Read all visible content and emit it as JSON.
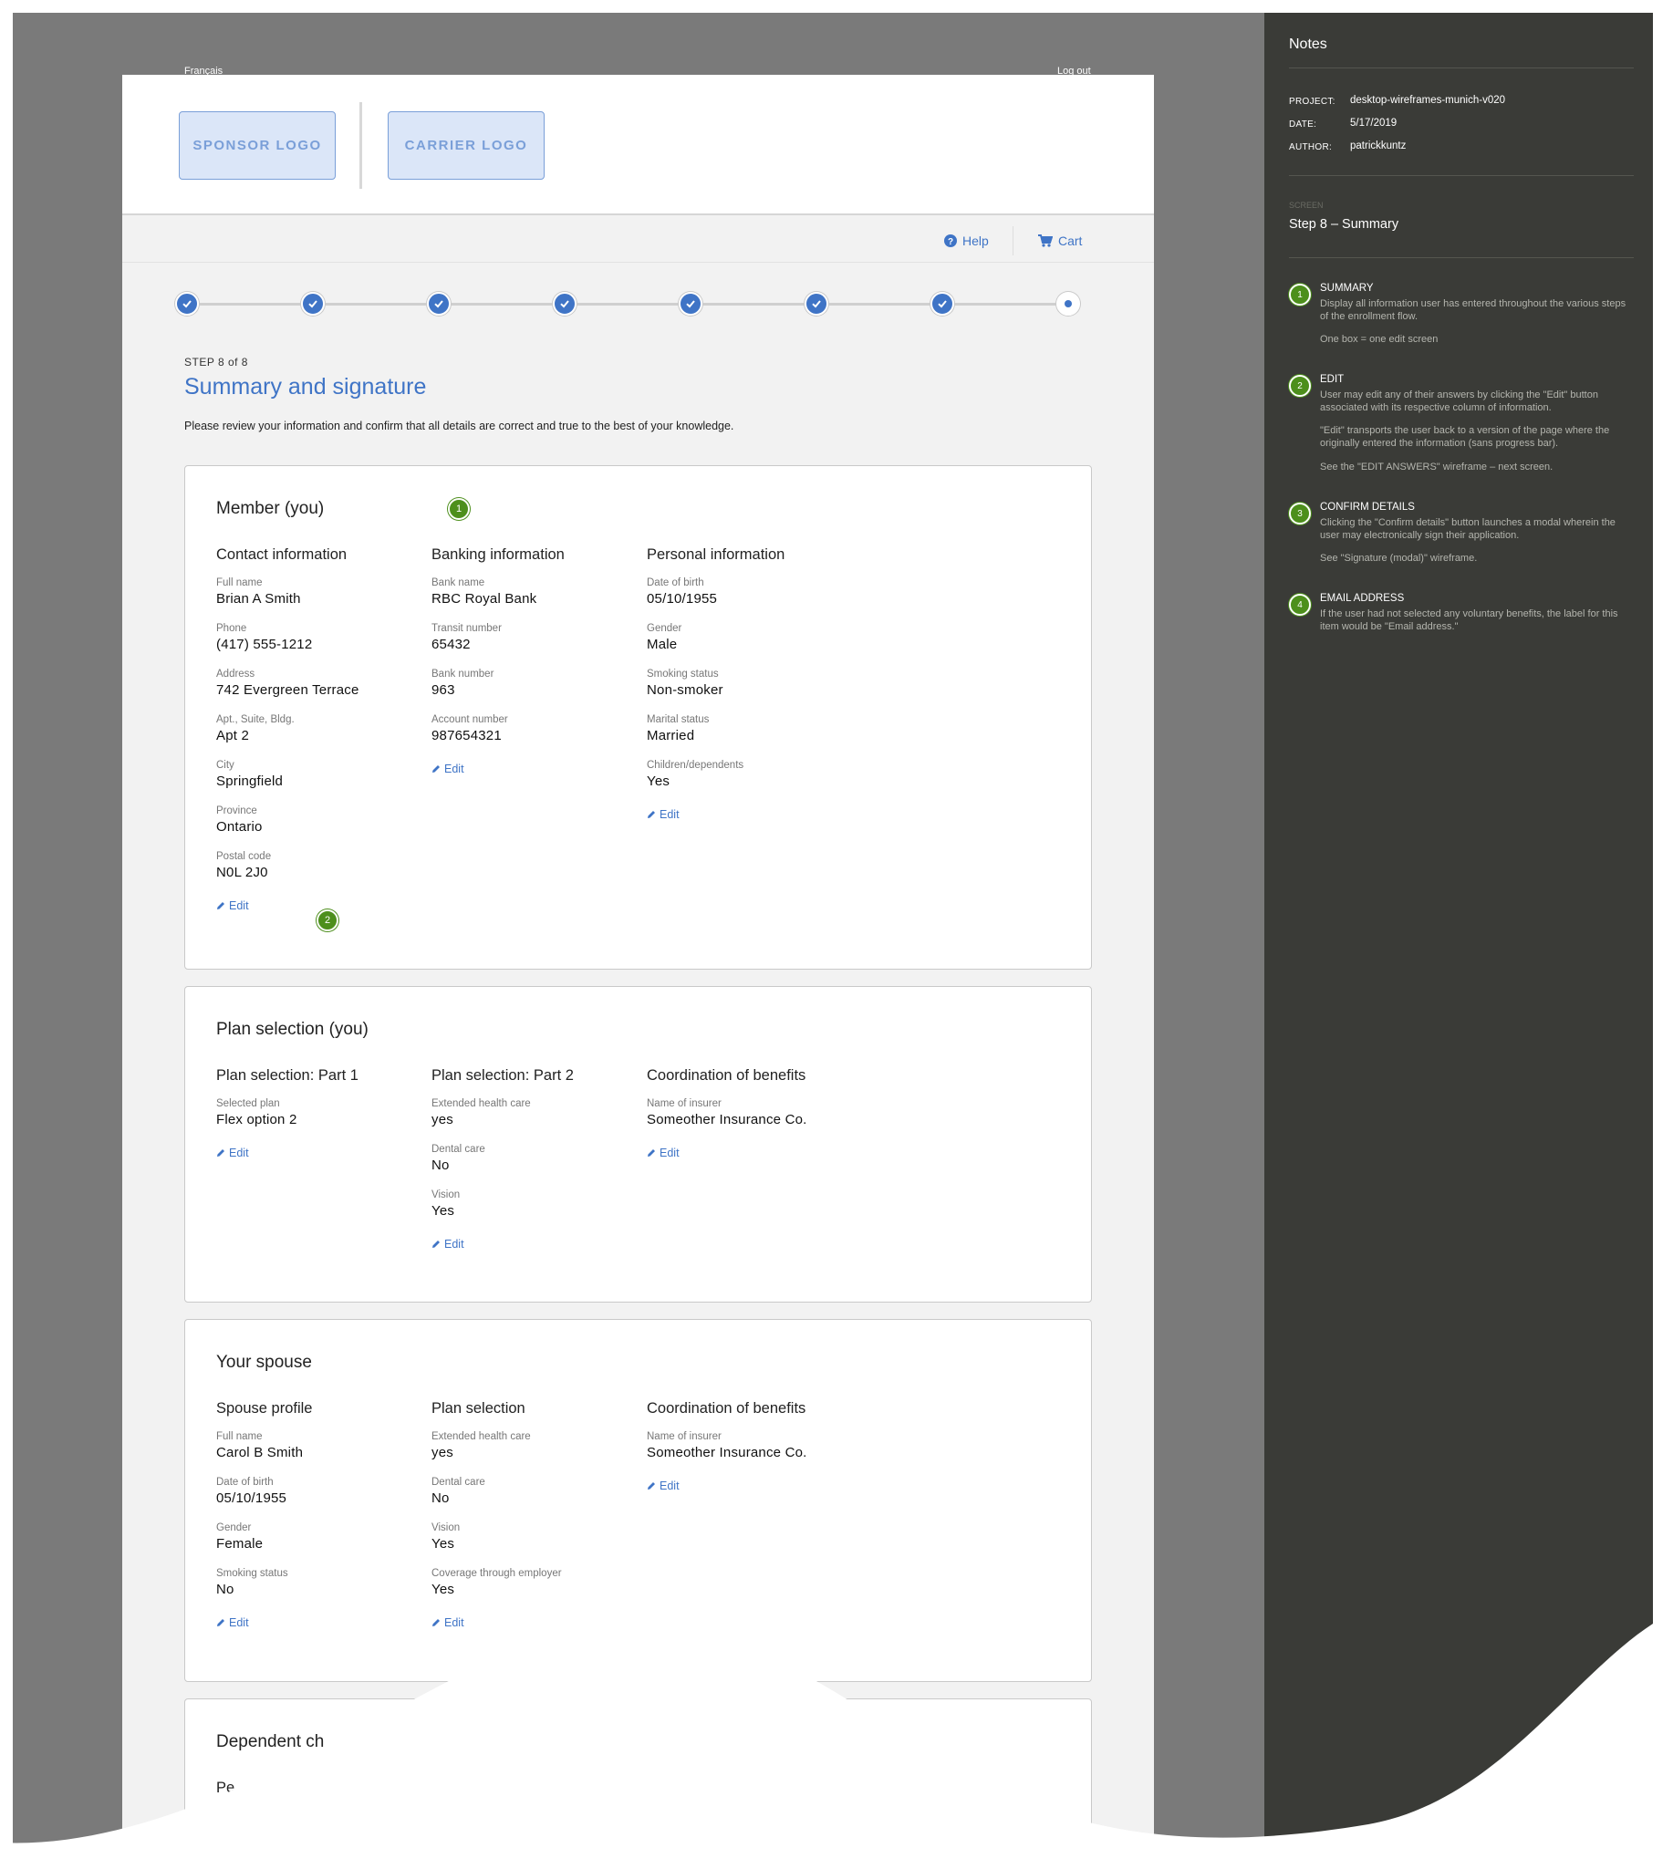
{
  "topbar": {
    "language": "Français",
    "logout": "Log out"
  },
  "header": {
    "sponsor_logo": "SPONSOR LOGO",
    "carrier_logo": "CARRIER LOGO"
  },
  "utility": {
    "help": "Help",
    "cart": "Cart"
  },
  "progress": {
    "total_steps": 8,
    "completed_steps": 7,
    "current_step": 8
  },
  "step_label": "STEP 8 of 8",
  "title": "Summary and signature",
  "intro": "Please review your information and confirm that all details are correct and true to the best of your knowledge.",
  "edit_label": "Edit",
  "member": {
    "title": "Member (you)",
    "badge": "1",
    "edit_badge": "2",
    "contact": {
      "title": "Contact information",
      "fields": [
        {
          "label": "Full name",
          "value": "Brian A Smith"
        },
        {
          "label": "Phone",
          "value": "(417) 555-1212"
        },
        {
          "label": "Address",
          "value": "742 Evergreen Terrace"
        },
        {
          "label": "Apt., Suite, Bldg.",
          "value": "Apt 2"
        },
        {
          "label": "City",
          "value": "Springfield"
        },
        {
          "label": "Province",
          "value": "Ontario"
        },
        {
          "label": "Postal code",
          "value": "N0L 2J0"
        }
      ]
    },
    "banking": {
      "title": "Banking information",
      "fields": [
        {
          "label": "Bank name",
          "value": "RBC Royal Bank"
        },
        {
          "label": "Transit number",
          "value": "65432"
        },
        {
          "label": "Bank number",
          "value": "963"
        },
        {
          "label": "Account number",
          "value": "987654321"
        }
      ]
    },
    "personal": {
      "title": "Personal information",
      "fields": [
        {
          "label": "Date of birth",
          "value": "05/10/1955"
        },
        {
          "label": "Gender",
          "value": "Male"
        },
        {
          "label": "Smoking status",
          "value": "Non-smoker"
        },
        {
          "label": "Marital status",
          "value": "Married"
        },
        {
          "label": "Children/dependents",
          "value": "Yes"
        }
      ]
    }
  },
  "plan": {
    "title": "Plan selection (you)",
    "part1": {
      "title": "Plan selection: Part 1",
      "fields": [
        {
          "label": "Selected plan",
          "value": "Flex option 2"
        }
      ]
    },
    "part2": {
      "title": "Plan selection: Part 2",
      "fields": [
        {
          "label": "Extended health care",
          "value": "yes"
        },
        {
          "label": "Dental care",
          "value": "No"
        },
        {
          "label": "Vision",
          "value": "Yes"
        }
      ]
    },
    "cob": {
      "title": "Coordination of benefits",
      "fields": [
        {
          "label": "Name of insurer",
          "value": "Someother Insurance Co."
        }
      ]
    }
  },
  "spouse": {
    "title": "Your spouse",
    "profile": {
      "title": "Spouse profile",
      "fields": [
        {
          "label": "Full name",
          "value": "Carol B Smith"
        },
        {
          "label": "Date of birth",
          "value": "05/10/1955"
        },
        {
          "label": "Gender",
          "value": "Female"
        },
        {
          "label": "Smoking status",
          "value": "No"
        }
      ]
    },
    "plan": {
      "title": "Plan selection",
      "fields": [
        {
          "label": "Extended health care",
          "value": "yes"
        },
        {
          "label": "Dental care",
          "value": "No"
        },
        {
          "label": "Vision",
          "value": "Yes"
        },
        {
          "label": "Coverage through employer",
          "value": "Yes"
        }
      ]
    },
    "cob": {
      "title": "Coordination of benefits",
      "fields": [
        {
          "label": "Name of insurer",
          "value": "Someother Insurance Co."
        }
      ]
    }
  },
  "dependent": {
    "title": "Dependent ch",
    "col_title": "Pe"
  },
  "notes": {
    "title": "Notes",
    "project_key": "PROJECT:",
    "project": "desktop-wireframes-munich-v020",
    "date_key": "DATE:",
    "date": "5/17/2019",
    "author_key": "AUTHOR:",
    "author": "patrickkuntz",
    "screen_key": "SCREEN",
    "screen": "Step 8 – Summary",
    "items": [
      {
        "n": "1",
        "heading": "SUMMARY",
        "p1": "Display all information user has entered throughout the various steps of the enrollment flow.",
        "p2": "One box = one edit screen"
      },
      {
        "n": "2",
        "heading": "EDIT",
        "p1": "User may edit any of their answers by clicking the \"Edit\" button associated with its respective column of information.",
        "p2": "\"Edit\" transports the user back to a version of the page where the originally entered the information (sans progress bar).",
        "p3": "See the \"EDIT ANSWERS\" wireframe – next screen."
      },
      {
        "n": "3",
        "heading": "CONFIRM DETAILS",
        "p1": "Clicking the \"Confirm details\" button launches a modal wherein the user may electronically sign their application.",
        "p2": "See \"Signature (modal)\" wireframe."
      },
      {
        "n": "4",
        "heading": "EMAIL ADDRESS",
        "p1": "If the user had not selected any voluntary benefits, the label for this item would be \"Email address.\""
      }
    ]
  },
  "colors": {
    "accent": "#3f74c6",
    "badge": "#4d8f1c",
    "notes_bg": "#3a3b37",
    "canvas": "#7a7a7a"
  }
}
